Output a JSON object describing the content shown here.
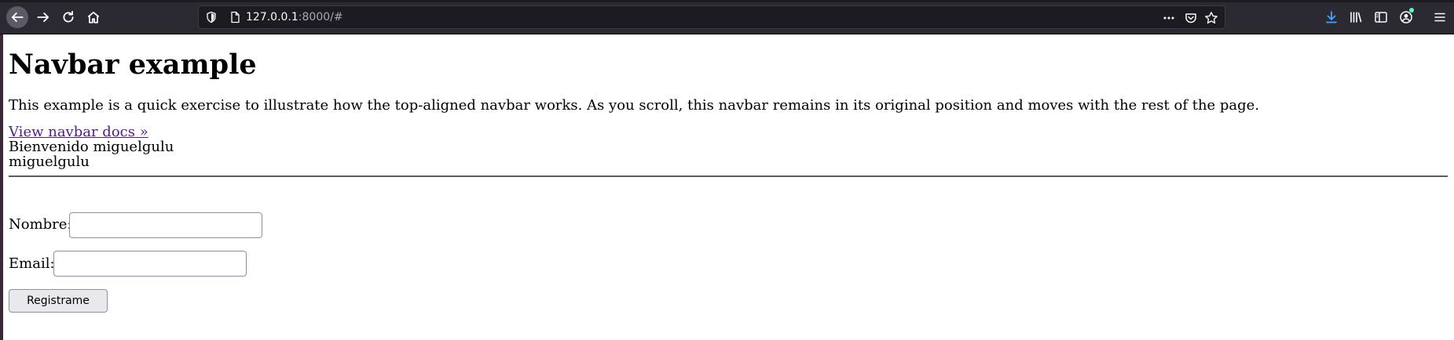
{
  "browser": {
    "url_host": "127.0.0.1",
    "url_rest": ":8000/#",
    "icons": [
      "back-icon",
      "forward-icon",
      "reload-icon",
      "home-icon",
      "shield-icon",
      "page-icon",
      "more-icon",
      "pocket-icon",
      "bookmark-star-icon",
      "download-icon",
      "library-icon",
      "sidebar-icon",
      "account-icon",
      "menu-icon"
    ]
  },
  "page": {
    "heading": "Navbar example",
    "lead": "This example is a quick exercise to illustrate how the top-aligned navbar works. As you scroll, this navbar remains in its original position and moves with the rest of the page.",
    "docs_link": "View navbar docs »",
    "welcome": "Bienvenido miguelgulu",
    "username": "miguelgulu"
  },
  "form": {
    "name_label": "Nombre:",
    "name_value": "",
    "email_label": "Email:",
    "email_value": "",
    "submit_label": "Registrame"
  }
}
